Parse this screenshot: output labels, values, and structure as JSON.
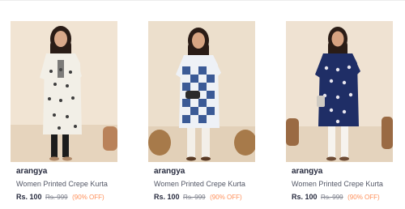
{
  "products": [
    {
      "brand": "arangya",
      "name": "Women Printed Crepe Kurta",
      "price": "Rs. 100",
      "mrp": "Rs. 999",
      "discount": "(90% OFF)",
      "image": {
        "kurta_color": "#f2efe7",
        "print_color": "#3d3d3d",
        "bottom_color": "#1c1c1c",
        "bg_color": "#f1e4d3"
      }
    },
    {
      "brand": "arangya",
      "name": "Women Printed Crepe Kurta",
      "price": "Rs. 100",
      "mrp": "Rs. 999",
      "discount": "(90% OFF)",
      "image": {
        "kurta_color": "#eef1f6",
        "print_color": "#3b5a96",
        "bottom_color": "#f3efe8",
        "bg_color": "#ecdfcc"
      }
    },
    {
      "brand": "arangya",
      "name": "Women Printed Crepe Kurta",
      "price": "Rs. 100",
      "mrp": "Rs. 999",
      "discount": "(90% OFF)",
      "image": {
        "kurta_color": "#1f2e66",
        "print_color": "#e8e6ef",
        "bottom_color": "#f6f3ee",
        "bg_color": "#efe2d2"
      }
    }
  ]
}
